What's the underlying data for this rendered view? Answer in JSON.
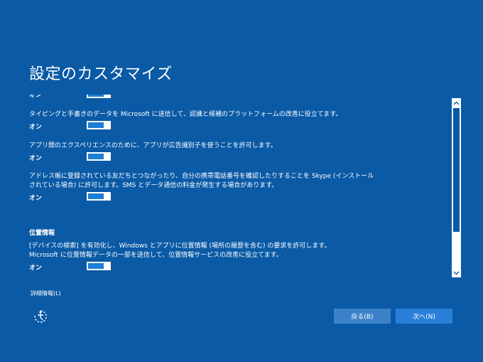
{
  "page": {
    "title": "設定のカスタマイズ"
  },
  "settings": {
    "clipped_state": "オン",
    "typing": {
      "description": "タイピングと手書きのデータを Microsoft に送信して、認識と候補のプラットフォームの改善に役立てます。",
      "state": "オン"
    },
    "ad_id": {
      "description": "アプリ間のエクスペリエンスのために、アプリが広告識別子を使うことを許可します。",
      "state": "オン"
    },
    "contacts": {
      "description_line1": "アドレス帳に登録されている友だちとつながったり、自分の携帯電話番号を確認したりすることを Skype (インストール",
      "description_line2": "されている場合) に許可します。SMS とデータ通信の料金が発生する場合があります。",
      "state": "オン"
    }
  },
  "location": {
    "heading": "位置情報",
    "description_line1": "[デバイスの検索] を有効化し、Windows とアプリに位置情報 (場所の履歴を含む) の要求を許可します。",
    "description_line2": "Microsoft に位置情報データの一部を送信して、位置情報サービスの改善に役立てます。",
    "state": "オン"
  },
  "footer": {
    "details_link": "詳細情報(L)",
    "back_button": "戻る(B)",
    "next_button": "次へ(N)"
  },
  "icons": {
    "scroll_up": "chevron-up-icon",
    "scroll_down": "chevron-down-icon",
    "accessibility": "ease-of-access-icon"
  },
  "colors": {
    "background": "#0a5aa6",
    "toggle_on": "#1a7fd6",
    "back_button": "#3b82c8",
    "next_button": "#2a7fd8"
  }
}
